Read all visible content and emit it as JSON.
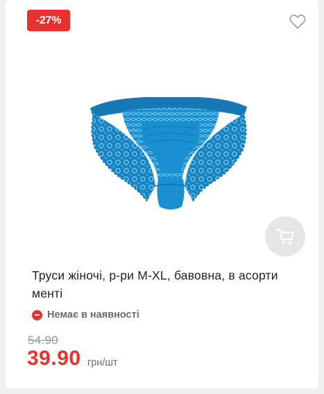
{
  "product": {
    "discount_badge": "-27%",
    "favorite_icon": "heart-outline-icon",
    "cart_icon": "shopping-cart-icon",
    "title": "Труси жіночі, р-ри M-XL, бавовна, в асорти менті",
    "stock_status": "Немає в наявності",
    "old_price": "54.90",
    "new_price": "39.90",
    "unit": "грн/шт"
  },
  "colors": {
    "accent": "#e8322f",
    "product_blue": "#1a8fcf",
    "cart_bg": "#e6e6e6"
  }
}
